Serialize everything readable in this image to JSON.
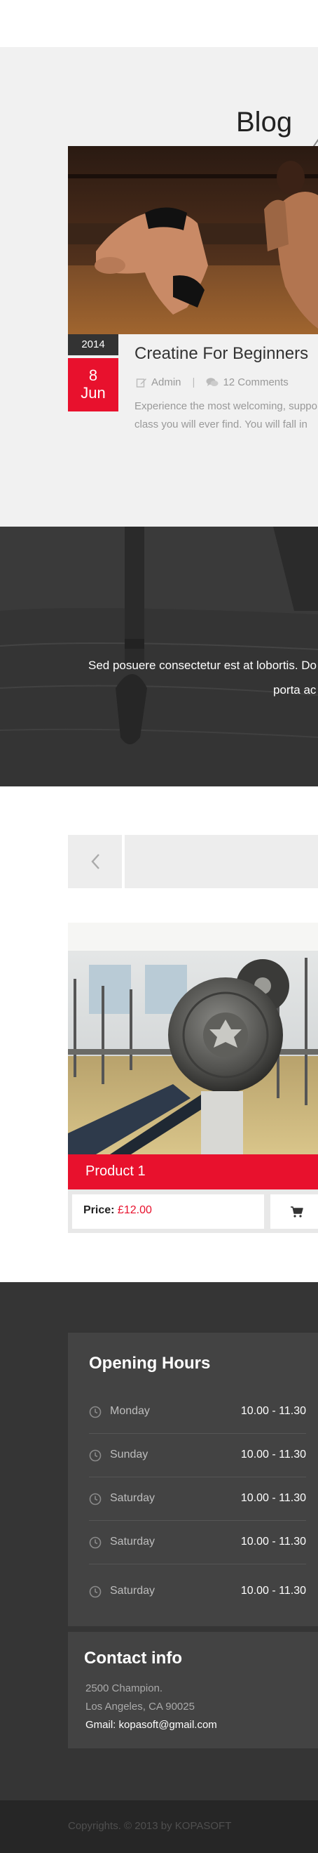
{
  "blog": {
    "title": "Blog",
    "post": {
      "year": "2014",
      "day": "8",
      "month": "Jun",
      "title": "Creatine For Beginners",
      "author": "Admin",
      "comments": "12 Comments",
      "excerpt_line1": "Experience the most welcoming, suppo",
      "excerpt_line2": "class you will ever find. You will fall in"
    }
  },
  "quote": {
    "line1": "Sed posuere consectetur est at lobortis. Do",
    "line2": "porta ac"
  },
  "products": {
    "items": [
      {
        "name": "Product 1",
        "price_label": "Price:",
        "price": "£12.00"
      }
    ]
  },
  "footer": {
    "hours": {
      "title": "Opening Hours",
      "rows": [
        {
          "day": "Monday",
          "time": "10.00 - 11.30"
        },
        {
          "day": "Sunday",
          "time": "10.00 - 11.30"
        },
        {
          "day": "Saturday",
          "time": "10.00 - 11.30"
        },
        {
          "day": "Saturday",
          "time": "10.00 - 11.30"
        },
        {
          "day": "Saturday",
          "time": "10.00 - 11.30"
        }
      ]
    },
    "contact": {
      "title": "Contact info",
      "address_line1": "2500 Champion.",
      "address_line2": "Los Angeles, CA 90025",
      "email": "Gmail: kopasoft@gmail.com"
    },
    "copyright": "Copyrights. © 2013 by KOPASOFT"
  },
  "colors": {
    "accent": "#e8112d",
    "footer_bg": "#353535",
    "panel_bg": "#434343"
  }
}
